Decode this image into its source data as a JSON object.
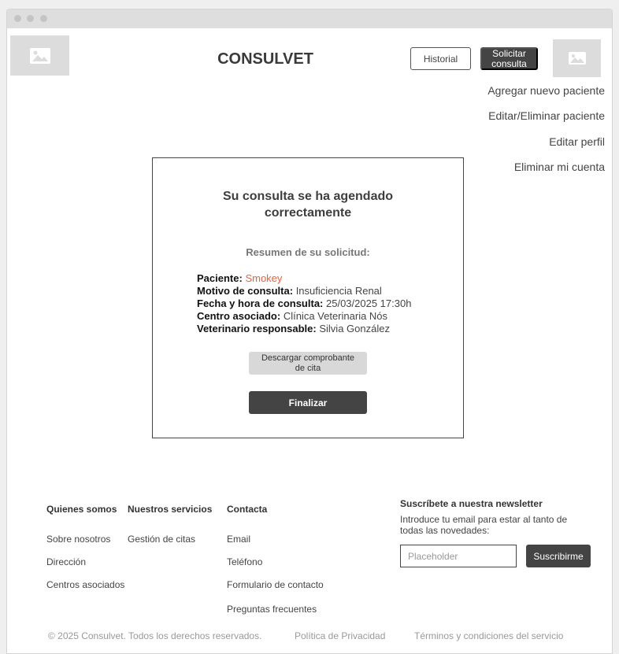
{
  "header": {
    "logo_icon": "image-icon",
    "brand": "CONSULVET",
    "history_label": "Historial",
    "request_label": "Solicitar consulta",
    "avatar_icon": "image-icon"
  },
  "account_menu": {
    "items": [
      "Agregar nuevo paciente",
      "Editar/Eliminar paciente",
      "Editar perfil",
      "Eliminar mi cuenta"
    ]
  },
  "confirmation": {
    "title": "Su consulta se ha agendado correctamente",
    "summary_title": "Resumen de su solicitud:",
    "details": [
      {
        "label": "Paciente:",
        "value": "Smokey"
      },
      {
        "label": "Motivo de consulta:",
        "value": "Insuficiencia Renal"
      },
      {
        "label": "Fecha y hora de consulta:",
        "value": "25/03/2025 17:30h"
      },
      {
        "label": "Centro asociado:",
        "value": "Clínica Veterinaria Nós"
      },
      {
        "label": "Veterinario responsable:",
        "value": "Silvia González"
      }
    ],
    "download_label": "Descargar comprobante de cita",
    "finish_label": "Finalizar",
    "accent_color": "#e8643c"
  },
  "footer": {
    "columns": [
      {
        "heading": "Quienes somos",
        "links": [
          "Sobre nosotros",
          "Dirección",
          "Centros asociados"
        ]
      },
      {
        "heading": "Nuestros servicios",
        "links": [
          "Gestión de citas"
        ]
      },
      {
        "heading": "Contacta",
        "links": [
          "Email",
          "Teléfono",
          "Formulario de contacto",
          "Preguntas frecuentes"
        ]
      }
    ],
    "newsletter": {
      "heading": "Suscríbete a nuestra newsletter",
      "description": "Introduce tu email para estar al tanto de todas las novedades:",
      "placeholder": "Placeholder",
      "button_label": "Suscribirme"
    },
    "legal": {
      "copyright": "© 2025 Consulvet. Todos los derechos reservados.",
      "privacy": "Política de Privacidad",
      "terms": "Términos y condiciones del servicio"
    }
  }
}
